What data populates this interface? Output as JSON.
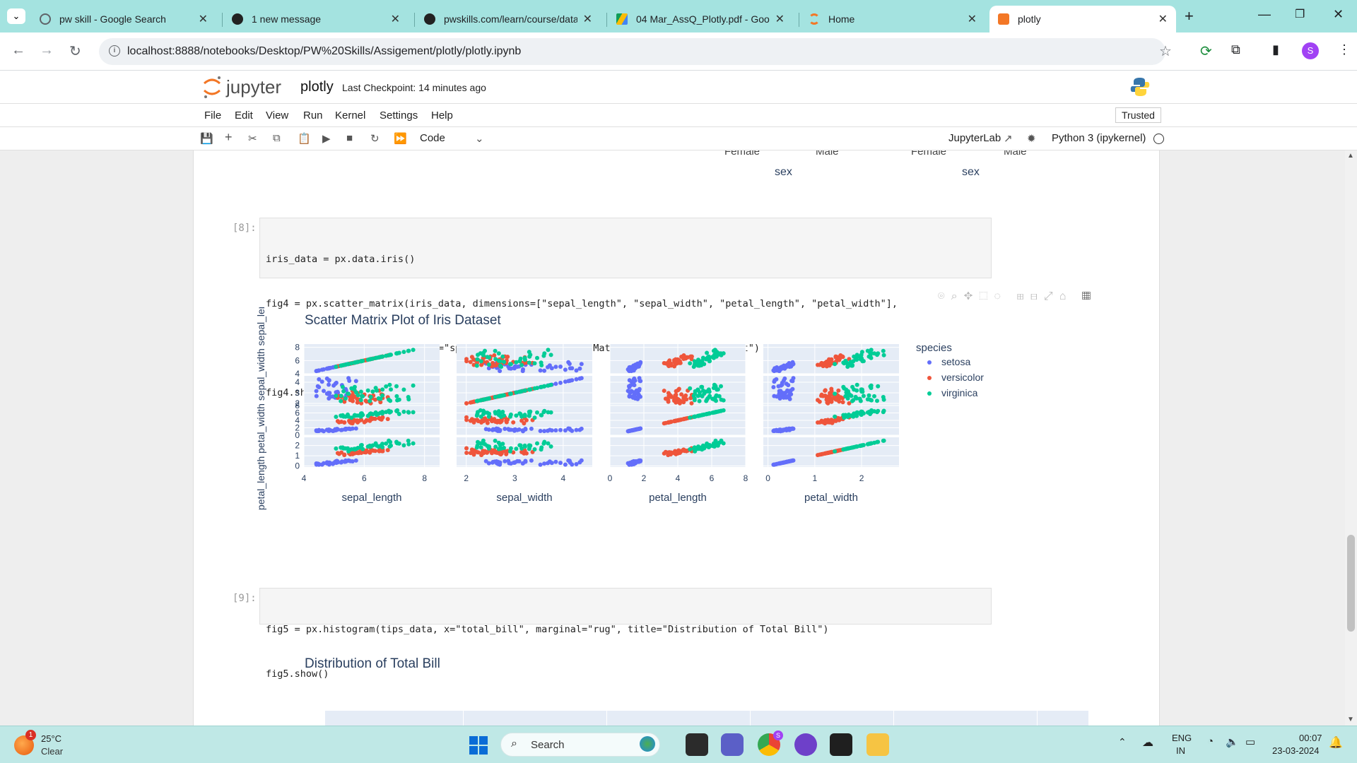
{
  "browser": {
    "tabs": [
      {
        "title": "pw skill - Google Search",
        "active": false,
        "fav_color": "#4285f4"
      },
      {
        "title": "1 new message",
        "active": false,
        "fav_color": "#222222"
      },
      {
        "title": "pwskills.com/learn/course/data",
        "active": false,
        "fav_color": "#222222"
      },
      {
        "title": "04 Mar_AssQ_Plotly.pdf - Goog",
        "active": false,
        "fav_color": "#34a853"
      },
      {
        "title": "Home",
        "active": false,
        "fav_color": "#f37726"
      },
      {
        "title": "plotly",
        "active": true,
        "fav_color": "#f37726"
      }
    ],
    "url": "localhost:8888/notebooks/Desktop/PW%20Skills/Assigement/plotly/plotly.ipynb",
    "profile_initial": "S"
  },
  "jupyter": {
    "logo_text": "jupyter",
    "notebook_name": "plotly",
    "checkpoint": "Last Checkpoint: 14 minutes ago",
    "menu": [
      "File",
      "Edit",
      "View",
      "Run",
      "Kernel",
      "Settings",
      "Help"
    ],
    "trusted": "Trusted",
    "cell_type": "Code",
    "jupyterlab_label": "JupyterLab",
    "kernel": "Python 3 (ipykernel)"
  },
  "prev_output": {
    "female_label": "Female",
    "male_label": "Male",
    "sex_label": "sex"
  },
  "cell8": {
    "prompt": "[8]:",
    "lines": [
      "iris_data = px.data.iris()",
      "fig4 = px.scatter_matrix(iris_data, dimensions=[\"sepal_length\", \"sepal_width\", \"petal_length\", \"petal_width\"],",
      "                         color=\"species\", title=\"Scatter Matrix Plot of Iris Dataset\")",
      "fig4.show()"
    ]
  },
  "cell9": {
    "prompt": "[9]:",
    "lines": [
      "fig5 = px.histogram(tips_data, x=\"total_bill\", marginal=\"rug\", title=\"Distribution of Total Bill\")",
      "fig5.show()"
    ]
  },
  "fig5_title": "Distribution of Total Bill",
  "chart_data": {
    "type": "scatter",
    "title": "Scatter Matrix Plot of Iris Dataset",
    "dimensions": [
      "sepal_length",
      "sepal_width",
      "petal_length",
      "petal_width"
    ],
    "overlapped_ylabel": "petal_length petal_width sepal_width sepal_length",
    "legend_title": "species",
    "legend_position": "right",
    "series": [
      {
        "name": "setosa",
        "color": "#636efa"
      },
      {
        "name": "versicolor",
        "color": "#ef553b"
      },
      {
        "name": "virginica",
        "color": "#00cc96"
      }
    ],
    "axes": {
      "sepal_length": {
        "range": [
          4,
          8.5
        ],
        "ticks": [
          "4",
          "6",
          "8"
        ],
        "tick_values": [
          4,
          6,
          8
        ]
      },
      "sepal_width": {
        "range": [
          1.8,
          4.6
        ],
        "ticks": [
          "2",
          "3",
          "4"
        ],
        "tick_values": [
          2,
          3,
          4
        ]
      },
      "petal_length": {
        "range": [
          0,
          8
        ],
        "ticks": [
          "0",
          "2",
          "4",
          "6",
          "8"
        ],
        "tick_values": [
          0,
          2,
          4,
          6,
          8
        ]
      },
      "petal_width": {
        "range": [
          -0.1,
          2.8
        ],
        "ticks": [
          "0",
          "1",
          "2"
        ],
        "tick_values": [
          0,
          1,
          2
        ]
      }
    },
    "ytick_labels": {
      "sepal_length": [
        "4",
        "6",
        "8"
      ],
      "sepal_width": [
        "2",
        "3",
        "4"
      ],
      "petal_length": [
        "0",
        "2",
        "4",
        "6",
        "8"
      ],
      "petal_width": [
        "0",
        "1",
        "2"
      ]
    },
    "species_stats": {
      "setosa": {
        "sepal_length": [
          4.3,
          5.8
        ],
        "sepal_width": [
          2.3,
          4.4
        ],
        "petal_length": [
          1.0,
          1.9
        ],
        "petal_width": [
          0.1,
          0.6
        ]
      },
      "versicolor": {
        "sepal_length": [
          4.9,
          7.0
        ],
        "sepal_width": [
          2.0,
          3.4
        ],
        "petal_length": [
          3.0,
          5.1
        ],
        "petal_width": [
          1.0,
          1.8
        ]
      },
      "virginica": {
        "sepal_length": [
          4.9,
          7.9
        ],
        "sepal_width": [
          2.2,
          3.8
        ],
        "petal_length": [
          4.5,
          6.9
        ],
        "petal_width": [
          1.4,
          2.5
        ]
      }
    }
  },
  "taskbar": {
    "weather_temp": "25°C",
    "weather_desc": "Clear",
    "weather_badge": "1",
    "search_placeholder": "Search",
    "lang_line1": "ENG",
    "lang_line2": "IN",
    "time": "00:07",
    "date": "23-03-2024",
    "chrome_badge": "S"
  }
}
